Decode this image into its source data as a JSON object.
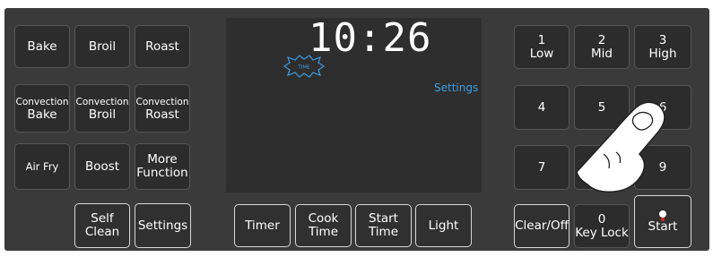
{
  "display": {
    "clock": "10:26",
    "time_badge": "TIME",
    "settings_label": "Settings"
  },
  "left_keys": {
    "bake": "Bake",
    "broil": "Broil",
    "roast": "Roast",
    "convection_bake": [
      "Convection",
      "Bake"
    ],
    "convection_broil": [
      "Convection",
      "Broil"
    ],
    "convection_roast": [
      "Convection",
      "Roast"
    ],
    "air_fry": "Air Fry",
    "boost": "Boost",
    "more_function": [
      "More",
      "Function"
    ],
    "self_clean": [
      "Self",
      "Clean"
    ],
    "settings": "Settings"
  },
  "middle_keys": {
    "timer": "Timer",
    "cook_time": [
      "Cook",
      "Time"
    ],
    "start_time": [
      "Start",
      "Time"
    ],
    "light": "Light"
  },
  "numpad": {
    "k1": [
      "1",
      "Low"
    ],
    "k2": [
      "2",
      "Mid"
    ],
    "k3": [
      "3",
      "High"
    ],
    "k4": "4",
    "k5": "5",
    "k6": "6",
    "k7": "7",
    "k9": "9",
    "clear_off": "Clear/Off",
    "k0": [
      "0",
      "Key Lock"
    ],
    "start": "Start"
  },
  "colors": {
    "panel": "#3a3a3a",
    "key": "#2c2c2c",
    "accent_blue": "#3d9be0",
    "indicator_red": "#d9261c"
  }
}
